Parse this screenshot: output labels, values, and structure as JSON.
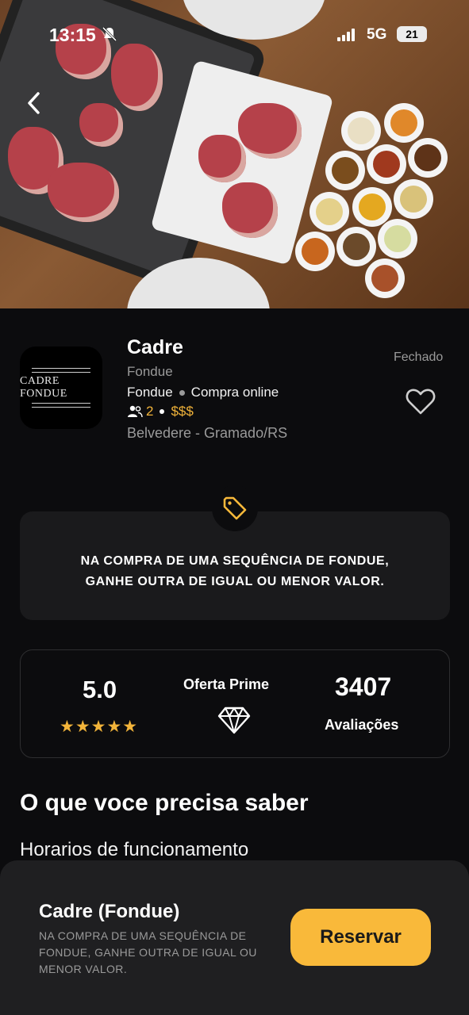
{
  "status_bar": {
    "time": "13:15",
    "network": "5G",
    "battery": "21"
  },
  "hero": {
    "icon": "back-chevron-icon"
  },
  "restaurant": {
    "logo_text": "CADRE FONDUE",
    "name": "Cadre",
    "category": "Fondue",
    "tag_1": "Fondue",
    "tag_2": "Compra online",
    "people_count": "2",
    "price_level": "$$$",
    "location": "Belvedere - Gramado/RS",
    "status": "Fechado",
    "favorite_icon": "heart-icon"
  },
  "promo": {
    "icon": "tag-icon",
    "line_1": "NA COMPRA DE UMA SEQUÊNCIA DE FONDUE,",
    "line_2": "GANHE OUTRA DE IGUAL OU MENOR VALOR."
  },
  "stats": {
    "rating": "5.0",
    "stars": "★★★★★",
    "prime_label": "Oferta Prime",
    "prime_icon": "diamond-icon",
    "reviews_count": "3407",
    "reviews_label": "Avaliações"
  },
  "info": {
    "section_title": "O que voce precisa saber",
    "hours_label": "Horarios de funcionamento"
  },
  "bottom_sheet": {
    "title": "Cadre (Fondue)",
    "description": "NA COMPRA DE UMA SEQUÊNCIA DE FONDUE, GANHE OUTRA DE IGUAL OU MENOR VALOR.",
    "reserve_label": "Reservar"
  },
  "colors": {
    "background": "#0c0c0e",
    "accent": "#f9b93a",
    "card": "#1a1a1c",
    "muted_text": "#9a9a9a"
  }
}
